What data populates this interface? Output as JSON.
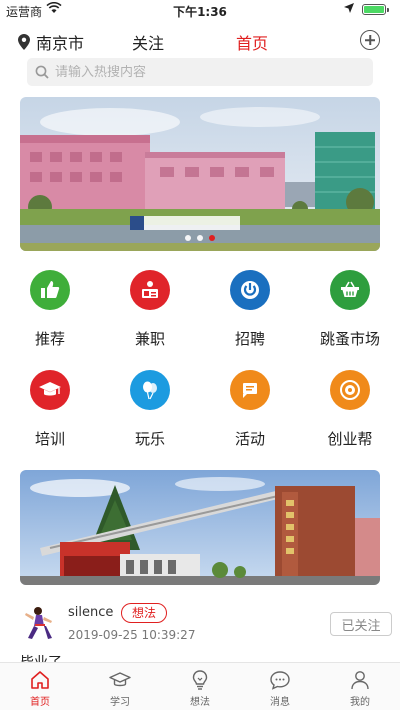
{
  "status_bar": {
    "carrier": "运营商",
    "time": "下午1:36"
  },
  "top_nav": {
    "city": "南京市",
    "tab_follow": "关注",
    "tab_home": "首页"
  },
  "search": {
    "placeholder": "请输入热搜内容"
  },
  "grid": [
    {
      "label": "推荐",
      "icon": "thumbs-up-icon",
      "color": "#3fae3a"
    },
    {
      "label": "兼职",
      "icon": "id-card-icon",
      "color": "#e0242a"
    },
    {
      "label": "招聘",
      "icon": "power-icon",
      "color": "#1a6fbf"
    },
    {
      "label": "跳蚤市场",
      "icon": "basket-icon",
      "color": "#2e9e3e"
    },
    {
      "label": "培训",
      "icon": "graduation-cap-icon",
      "color": "#e0242a"
    },
    {
      "label": "玩乐",
      "icon": "balloon-icon",
      "color": "#1c9be0"
    },
    {
      "label": "活动",
      "icon": "flag-icon",
      "color": "#f08a1a"
    },
    {
      "label": "创业帮",
      "icon": "badge-icon",
      "color": "#f08a1a"
    }
  ],
  "post": {
    "username": "silence",
    "tag": "想法",
    "time": "2019-09-25 10:39:27",
    "follow_label": "已关注",
    "text": "毕业了"
  },
  "tab_bar": [
    {
      "label": "首页",
      "icon": "home-icon"
    },
    {
      "label": "学习",
      "icon": "graduation-cap-icon"
    },
    {
      "label": "想法",
      "icon": "bulb-icon"
    },
    {
      "label": "消息",
      "icon": "chat-icon"
    },
    {
      "label": "我的",
      "icon": "user-icon"
    }
  ],
  "colors": {
    "accent": "#e02020"
  }
}
